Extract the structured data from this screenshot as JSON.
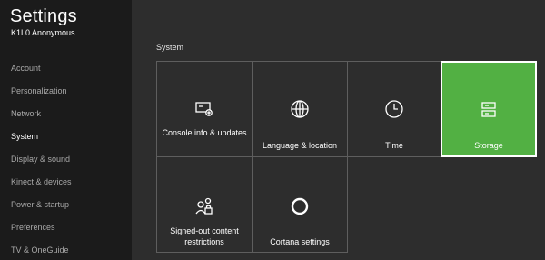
{
  "header": {
    "title": "Settings",
    "user": "K1L0 Anonymous"
  },
  "sidebar": {
    "items": [
      {
        "label": "Account"
      },
      {
        "label": "Personalization"
      },
      {
        "label": "Network"
      },
      {
        "label": "System",
        "active": true
      },
      {
        "label": "Display & sound"
      },
      {
        "label": "Kinect & devices"
      },
      {
        "label": "Power & startup"
      },
      {
        "label": "Preferences"
      },
      {
        "label": "TV & OneGuide"
      }
    ]
  },
  "main": {
    "section_label": "System",
    "tiles": [
      {
        "label": "Console info & updates",
        "icon": "console-info-icon"
      },
      {
        "label": "Language & location",
        "icon": "globe-icon"
      },
      {
        "label": "Time",
        "icon": "clock-icon"
      },
      {
        "label": "Storage",
        "icon": "storage-icon",
        "selected": true
      },
      {
        "label": "Signed-out content restrictions",
        "icon": "people-lock-icon"
      },
      {
        "label": "Cortana settings",
        "icon": "cortana-icon"
      }
    ]
  },
  "colors": {
    "accent": "#52b043",
    "sidebar_bg": "#1b1b1b",
    "content_bg": "#2d2d2d",
    "tile_border": "#5e5e5e"
  }
}
